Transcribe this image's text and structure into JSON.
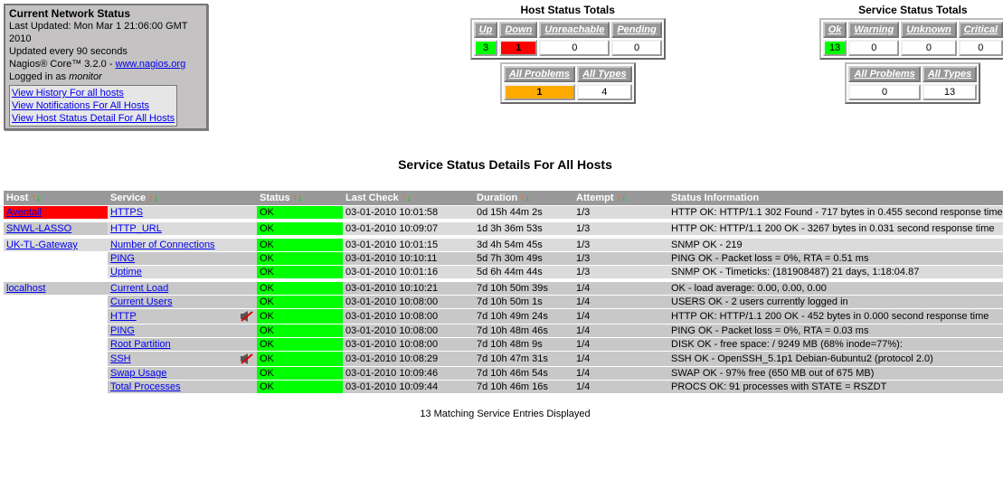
{
  "info": {
    "title": "Current Network Status",
    "last_updated": "Last Updated: Mon Mar 1 21:06:00 GMT 2010",
    "update_every": "Updated every 90 seconds",
    "product_prefix": "Nagios® Core™ 3.2.0 - ",
    "product_link": "www.nagios.org",
    "logged_in_prefix": "Logged in as ",
    "logged_in_user": "monitor",
    "links": {
      "history": "View History For all hosts",
      "notifications": "View Notifications For All Hosts",
      "hoststatus": "View Host Status Detail For All Hosts"
    }
  },
  "host_totals": {
    "title": "Host Status Totals",
    "headers": {
      "up": "Up",
      "down": "Down",
      "unreachable": "Unreachable",
      "pending": "Pending"
    },
    "values": {
      "up": "3",
      "down": "1",
      "unreachable": "0",
      "pending": "0"
    },
    "problems_header": "All Problems",
    "types_header": "All Types",
    "problems_value": "1",
    "types_value": "4"
  },
  "service_totals": {
    "title": "Service Status Totals",
    "headers": {
      "ok": "Ok",
      "warning": "Warning",
      "unknown": "Unknown",
      "critical": "Critical"
    },
    "values": {
      "ok": "13",
      "warning": "0",
      "unknown": "0",
      "critical": "0"
    },
    "problems_header": "All Problems",
    "types_header": "All Types",
    "problems_value": "0",
    "types_value": "13"
  },
  "main_title": "Service Status Details For All Hosts",
  "columns": {
    "host": "Host",
    "service": "Service",
    "status": "Status",
    "last_check": "Last Check",
    "duration": "Duration",
    "attempt": "Attempt",
    "status_info": "Status Information"
  },
  "rows": [
    {
      "host": "Aventail",
      "host_state": "down",
      "service": "HTTPS",
      "status": "OK",
      "last_check": "03-01-2010 10:01:58",
      "duration": "0d 15h 44m 2s",
      "attempt": "1/3",
      "info": "HTTP OK: HTTP/1.1 302 Found - 717 bytes in 0.455 second response time",
      "icon": false
    },
    {
      "spacer": true
    },
    {
      "host": "SNWL-LASSO",
      "host_state": "odd",
      "service": "HTTP_URL",
      "status": "OK",
      "last_check": "03-01-2010 10:09:07",
      "duration": "1d 3h 36m 53s",
      "attempt": "1/3",
      "info": "HTTP OK: HTTP/1.1 200 OK - 3267 bytes in 0.031 second response time",
      "icon": false
    },
    {
      "spacer": true
    },
    {
      "host": "UK-TL-Gateway",
      "host_state": "even",
      "service": "Number of Connections",
      "status": "OK",
      "last_check": "03-01-2010 10:01:15",
      "duration": "3d 4h 54m 45s",
      "attempt": "1/3",
      "info": "SNMP OK - 219",
      "icon": false
    },
    {
      "host": "",
      "host_state": "blank",
      "service": "PING",
      "status": "OK",
      "last_check": "03-01-2010 10:10:11",
      "duration": "5d 7h 30m 49s",
      "attempt": "1/3",
      "info": "PING OK - Packet loss = 0%, RTA = 0.51 ms",
      "icon": false,
      "parity": "odd"
    },
    {
      "host": "",
      "host_state": "blank",
      "service": "Uptime",
      "status": "OK",
      "last_check": "03-01-2010 10:01:16",
      "duration": "5d 6h 44m 44s",
      "attempt": "1/3",
      "info": "SNMP OK - Timeticks: (181908487) 21 days, 1:18:04.87",
      "icon": false
    },
    {
      "spacer": true
    },
    {
      "host": "localhost",
      "host_state": "odd",
      "service": "Current Load",
      "status": "OK",
      "last_check": "03-01-2010 10:10:21",
      "duration": "7d 10h 50m 39s",
      "attempt": "1/4",
      "info": "OK - load average: 0.00, 0.00, 0.00",
      "icon": false,
      "parity": "odd"
    },
    {
      "host": "",
      "host_state": "blank",
      "service": "Current Users",
      "status": "OK",
      "last_check": "03-01-2010 10:08:00",
      "duration": "7d 10h 50m 1s",
      "attempt": "1/4",
      "info": "USERS OK - 2 users currently logged in",
      "icon": false
    },
    {
      "host": "",
      "host_state": "blank",
      "service": "HTTP",
      "status": "OK",
      "last_check": "03-01-2010 10:08:00",
      "duration": "7d 10h 49m 24s",
      "attempt": "1/4",
      "info": "HTTP OK: HTTP/1.1 200 OK - 452 bytes in 0.000 second response time",
      "icon": true,
      "parity": "odd"
    },
    {
      "host": "",
      "host_state": "blank",
      "service": "PING",
      "status": "OK",
      "last_check": "03-01-2010 10:08:00",
      "duration": "7d 10h 48m 46s",
      "attempt": "1/4",
      "info": "PING OK - Packet loss = 0%, RTA = 0.03 ms",
      "icon": false
    },
    {
      "host": "",
      "host_state": "blank",
      "service": "Root Partition",
      "status": "OK",
      "last_check": "03-01-2010 10:08:00",
      "duration": "7d 10h 48m 9s",
      "attempt": "1/4",
      "info": "DISK OK - free space: / 9249 MB (68% inode=77%):",
      "icon": false,
      "parity": "odd"
    },
    {
      "host": "",
      "host_state": "blank",
      "service": "SSH",
      "status": "OK",
      "last_check": "03-01-2010 10:08:29",
      "duration": "7d 10h 47m 31s",
      "attempt": "1/4",
      "info": "SSH OK - OpenSSH_5.1p1 Debian-6ubuntu2 (protocol 2.0)",
      "icon": true
    },
    {
      "host": "",
      "host_state": "blank",
      "service": "Swap Usage",
      "status": "OK",
      "last_check": "03-01-2010 10:09:46",
      "duration": "7d 10h 46m 54s",
      "attempt": "1/4",
      "info": "SWAP OK - 97% free (650 MB out of 675 MB)",
      "icon": false,
      "parity": "odd"
    },
    {
      "host": "",
      "host_state": "blank",
      "service": "Total Processes",
      "status": "OK",
      "last_check": "03-01-2010 10:09:44",
      "duration": "7d 10h 46m 16s",
      "attempt": "1/4",
      "info": "PROCS OK: 91 processes with STATE = RSZDT",
      "icon": false
    }
  ],
  "footer": "13 Matching Service Entries Displayed"
}
